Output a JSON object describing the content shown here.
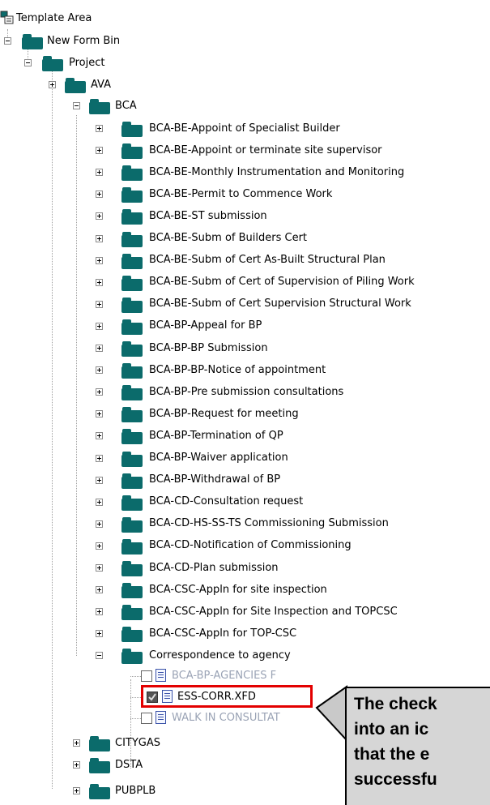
{
  "tree": {
    "root": {
      "label": "Template Area"
    },
    "level1": {
      "label": "New Form Bin"
    },
    "level2": {
      "label": "Project"
    },
    "projects_before": [
      {
        "label": "AVA"
      },
      {
        "label": "BCA"
      }
    ],
    "bca_forms": [
      {
        "label": "BCA-BE-Appoint of Specialist Builder"
      },
      {
        "label": "BCA-BE-Appoint or terminate site supervisor"
      },
      {
        "label": "BCA-BE-Monthly Instrumentation and Monitoring"
      },
      {
        "label": "BCA-BE-Permit to Commence Work"
      },
      {
        "label": "BCA-BE-ST submission"
      },
      {
        "label": "BCA-BE-Subm of Builders Cert"
      },
      {
        "label": "BCA-BE-Subm of Cert As-Built Structural Plan"
      },
      {
        "label": "BCA-BE-Subm of Cert of Supervision of Piling Work"
      },
      {
        "label": "BCA-BE-Subm of Cert Supervision Structural Work"
      },
      {
        "label": "BCA-BP-Appeal for BP"
      },
      {
        "label": "BCA-BP-BP Submission"
      },
      {
        "label": "BCA-BP-BP-Notice of appointment"
      },
      {
        "label": "BCA-BP-Pre submission consultations"
      },
      {
        "label": "BCA-BP-Request for meeting"
      },
      {
        "label": "BCA-BP-Termination of QP"
      },
      {
        "label": "BCA-BP-Waiver application"
      },
      {
        "label": "BCA-BP-Withdrawal of BP"
      },
      {
        "label": "BCA-CD-Consultation request"
      },
      {
        "label": "BCA-CD-HS-SS-TS Commissioning Submission"
      },
      {
        "label": "BCA-CD-Notification of Commissioning"
      },
      {
        "label": "BCA-CD-Plan submission"
      },
      {
        "label": "BCA-CSC-Appln for site inspection"
      },
      {
        "label": "BCA-CSC-Appln for Site Inspection and TOPCSC"
      },
      {
        "label": "BCA-CSC-Appln for TOP-CSC"
      },
      {
        "label": "Correspondence to agency"
      }
    ],
    "correspondence_files": [
      {
        "label": "BCA-BP-AGENCIES F"
      },
      {
        "label": "ESS-CORR.XFD"
      },
      {
        "label": "WALK IN CONSULTAT"
      }
    ],
    "projects_after": [
      {
        "label": "CITYGAS"
      },
      {
        "label": "DSTA"
      },
      {
        "label": "PUBPLB"
      }
    ]
  },
  "callout": {
    "lines": [
      "The check",
      "into an ic",
      "that the e",
      "successfu"
    ]
  },
  "colors": {
    "highlight": "#e30000",
    "folder": "#0b6b6b",
    "callout_bg": "#d6d6d6"
  }
}
